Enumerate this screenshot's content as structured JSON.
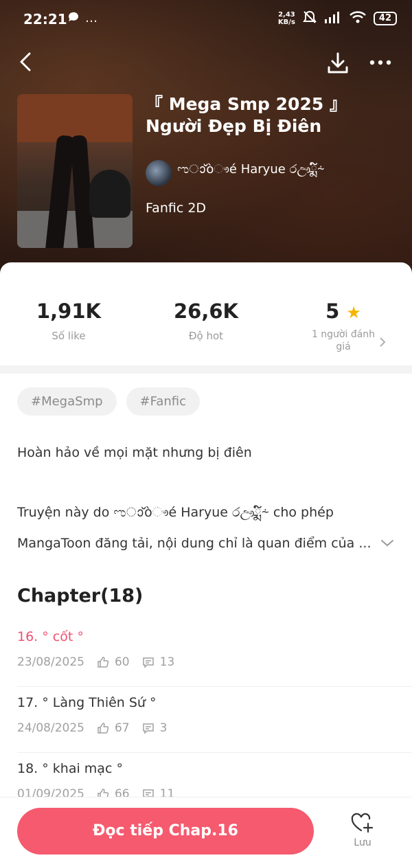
{
  "status_bar": {
    "time": "22:21",
    "extra": "…",
    "net_speed_value": "2,43",
    "net_speed_unit": "KB/s",
    "battery": "42"
  },
  "book": {
    "title": "『 Mega Smp 2025 』 Người Đẹp Bị Điên",
    "author": "ಌാ്òෟé Ηaryue රඌྨ໌⸞",
    "genre": "Fanfic 2D"
  },
  "stats": {
    "likes_value": "1,91K",
    "likes_label": "Số like",
    "hot_value": "26,6K",
    "hot_label": "Độ hot",
    "rating_value": "5",
    "rating_label": "1 người đánh giá"
  },
  "tags": [
    "#MegaSmp",
    "#Fanfic"
  ],
  "description": "Hoàn hảo về mọi mặt nhưng bị điên",
  "notice_line1": "Truyện này do ಌാ്òෟé Ηaryue රඌྨ໌⸞ cho phép",
  "notice_line2": "MangaToon đăng tải, nội dung chỉ là quan điểm của ...",
  "chapter_heading": "Chapter(18)",
  "chapters": [
    {
      "title": "16. ° cốt °",
      "date": "23/08/2025",
      "likes": "60",
      "comments": "13",
      "active": true
    },
    {
      "title": "17. ° Làng Thiên Sứ °",
      "date": "24/08/2025",
      "likes": "67",
      "comments": "3",
      "active": false
    },
    {
      "title": "18. ° khai mạc °",
      "date": "01/09/2025",
      "likes": "66",
      "comments": "11",
      "active": false
    }
  ],
  "bottom": {
    "read_button": "Đọc tiếp Chap.16",
    "save_label": "Lưu"
  },
  "colors": {
    "accent": "#f55a6f",
    "active_chapter": "#f0506e",
    "star": "#f6b400"
  }
}
